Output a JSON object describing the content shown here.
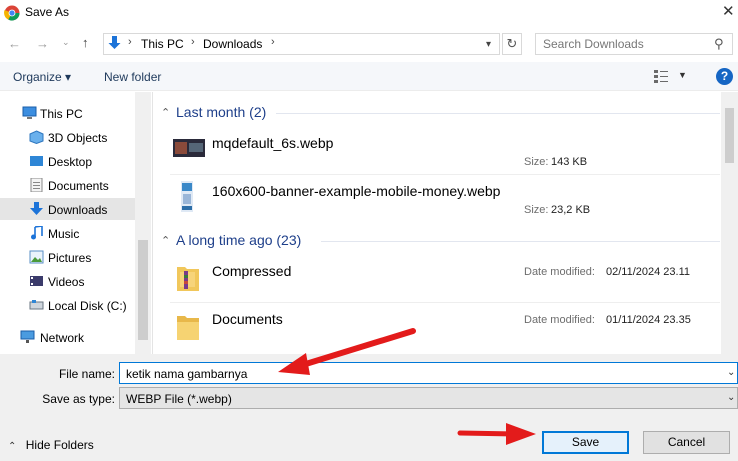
{
  "window": {
    "title": "Save As"
  },
  "address": {
    "crumbs": [
      "This PC",
      "Downloads"
    ],
    "search_placeholder": "Search Downloads"
  },
  "toolbar": {
    "organize": "Organize ▾",
    "new_folder": "New folder",
    "help": "?"
  },
  "sidebar": {
    "items": [
      {
        "label": "This PC",
        "icon": "pc-icon"
      },
      {
        "label": "3D Objects",
        "icon": "3d-objects-icon"
      },
      {
        "label": "Desktop",
        "icon": "desktop-icon"
      },
      {
        "label": "Documents",
        "icon": "documents-icon"
      },
      {
        "label": "Downloads",
        "icon": "downloads-icon",
        "selected": true
      },
      {
        "label": "Music",
        "icon": "music-icon"
      },
      {
        "label": "Pictures",
        "icon": "pictures-icon"
      },
      {
        "label": "Videos",
        "icon": "videos-icon"
      },
      {
        "label": "Local Disk (C:)",
        "icon": "local-disk-icon"
      },
      {
        "label": "Network",
        "icon": "network-icon"
      }
    ]
  },
  "files": {
    "groups": [
      {
        "header": "Last month (2)",
        "items": [
          {
            "name": "mqdefault_6s.webp",
            "meta_label": "Size:",
            "meta_value": "143 KB"
          },
          {
            "name": "160x600-banner-example-mobile-money.webp",
            "meta_label": "Size:",
            "meta_value": "23,2 KB"
          }
        ]
      },
      {
        "header": "A long time ago (23)",
        "items": [
          {
            "name": "Compressed",
            "meta_label": "Date modified:",
            "meta_value": "02/11/2024 23.11"
          },
          {
            "name": "Documents",
            "meta_label": "Date modified:",
            "meta_value": "01/11/2024 23.35"
          }
        ]
      }
    ]
  },
  "form": {
    "file_name_label": "File name:",
    "file_name_value": "ketik nama gambarnya",
    "save_type_label": "Save as type:",
    "save_type_value": "WEBP File (*.webp)"
  },
  "footer": {
    "hide_folders": "Hide Folders",
    "save": "Save",
    "cancel": "Cancel"
  },
  "colors": {
    "accent": "#0078d7",
    "annotation_arrow": "#e31b1b",
    "group_header": "#1e3f8a"
  }
}
